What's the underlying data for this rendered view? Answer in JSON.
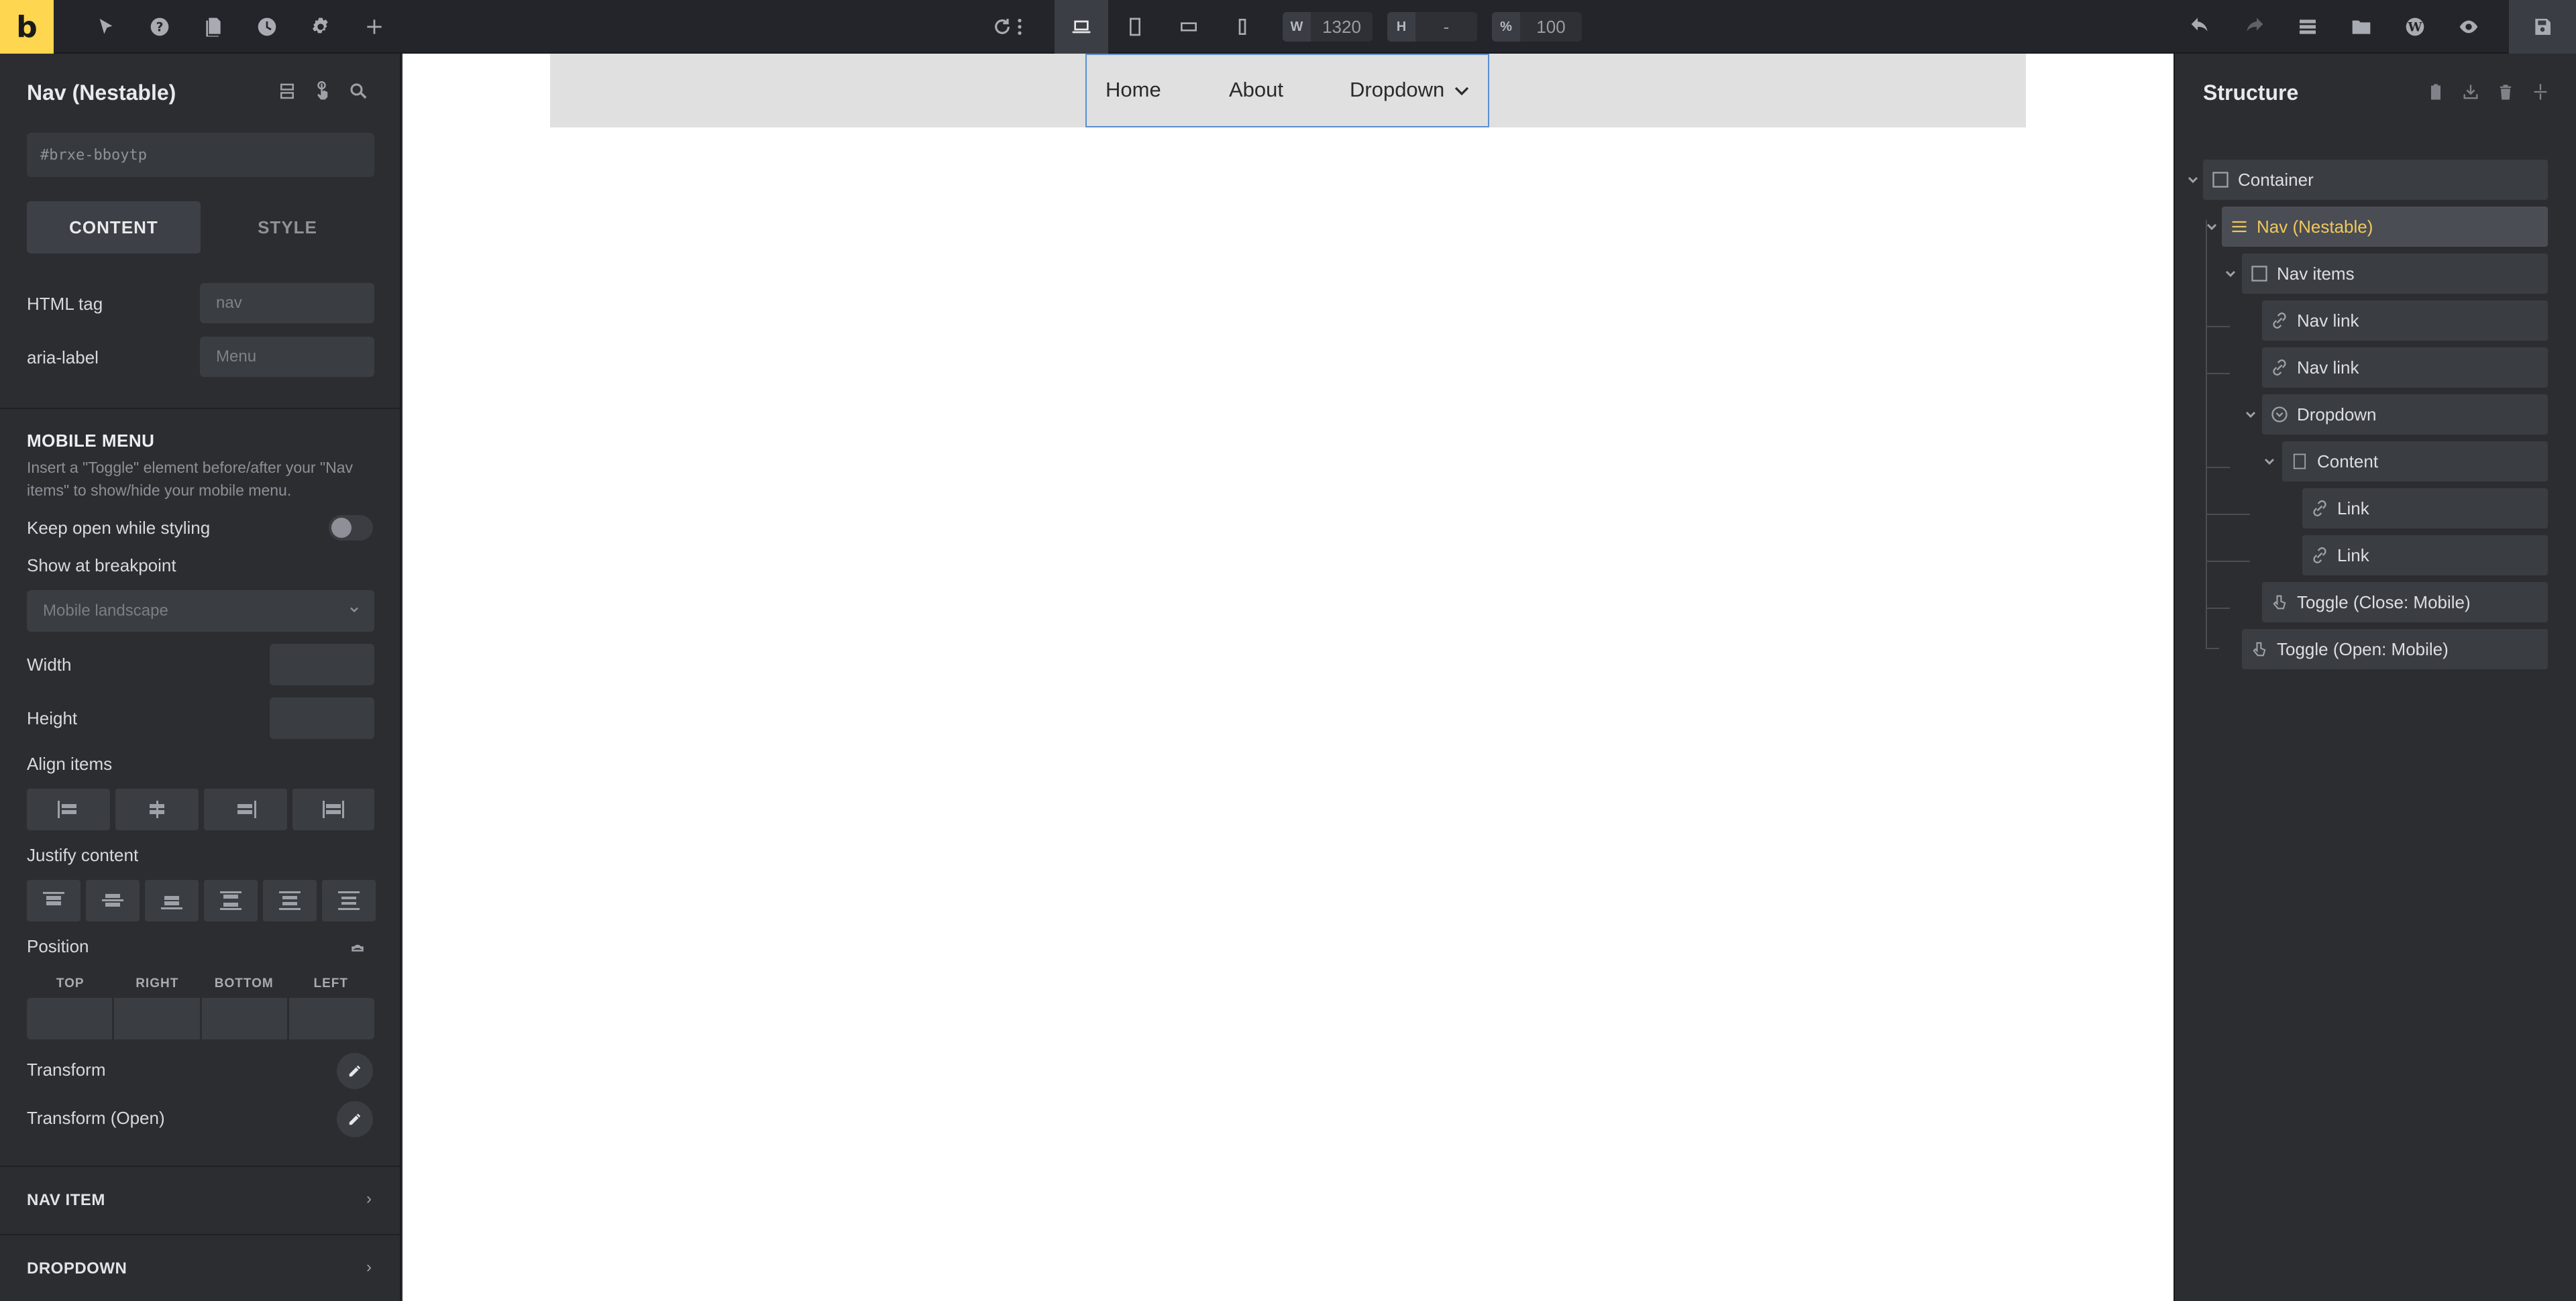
{
  "app": {
    "logo": "b"
  },
  "toolbar": {
    "width_label": "W",
    "width_value": "1320",
    "height_label": "H",
    "height_value": "-",
    "zoom_label": "%",
    "zoom_value": "100"
  },
  "left_panel": {
    "title": "Nav (Nestable)",
    "element_id": "#brxe-bboytp",
    "tabs": [
      "CONTENT",
      "STYLE"
    ],
    "html_tag_label": "HTML tag",
    "html_tag_placeholder": "nav",
    "aria_label": "aria-label",
    "aria_placeholder": "Menu",
    "mobile_menu": {
      "heading": "MOBILE MENU",
      "description": "Insert a \"Toggle\" element before/after your \"Nav items\" to show/hide your mobile menu.",
      "keep_open_label": "Keep open while styling",
      "keep_open": false,
      "breakpoint_label": "Show at breakpoint",
      "breakpoint_value": "Mobile landscape"
    },
    "width_label": "Width",
    "height_label": "Height",
    "align_items_label": "Align items",
    "justify_content_label": "Justify content",
    "position_label": "Position",
    "position_sides": [
      "TOP",
      "RIGHT",
      "BOTTOM",
      "LEFT"
    ],
    "transform_label": "Transform",
    "transform_open_label": "Transform (Open)",
    "accordions": [
      "NAV ITEM",
      "DROPDOWN"
    ]
  },
  "canvas": {
    "nav_links": [
      "Home",
      "About",
      "Dropdown"
    ]
  },
  "structure": {
    "title": "Structure",
    "items": [
      {
        "label": "Container",
        "icon": "container-icon"
      },
      {
        "label": "Nav (Nestable)",
        "icon": "menu-icon",
        "selected": true
      },
      {
        "label": "Nav items",
        "icon": "container-icon"
      },
      {
        "label": "Nav link",
        "icon": "link-icon"
      },
      {
        "label": "Nav link",
        "icon": "link-icon"
      },
      {
        "label": "Dropdown",
        "icon": "dropdown-icon"
      },
      {
        "label": "Content",
        "icon": "content-icon"
      },
      {
        "label": "Link",
        "icon": "link-icon"
      },
      {
        "label": "Link",
        "icon": "link-icon"
      },
      {
        "label": "Toggle (Close: Mobile)",
        "icon": "toggle-icon"
      },
      {
        "label": "Toggle (Open: Mobile)",
        "icon": "toggle-icon"
      }
    ]
  },
  "colors": {
    "accent": "#ffd64f",
    "selected_text": "#f0c85a",
    "selection_border": "#5b8fd0"
  }
}
